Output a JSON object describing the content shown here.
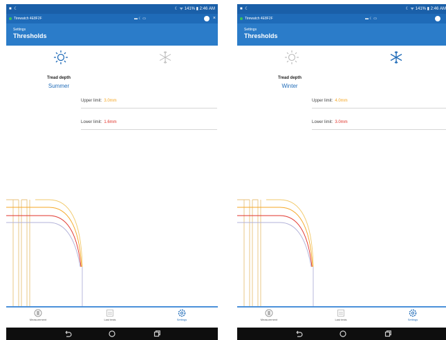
{
  "screens": [
    {
      "status_left": "■ ☾",
      "status_right": "☾ ᯤ 141% ▮ 2:46 AM",
      "device_name": "Tirewatch 4E8F2F",
      "notif_mid": "▬ ☾ ▭",
      "close_symbol": "×",
      "breadcrumb": "Settings",
      "title": "Thresholds",
      "season_icons": [
        "sun-icon",
        "snowflake-icon"
      ],
      "active_season": "summer",
      "tread_label": "Tread depth",
      "season_name": "Summer",
      "upper_limit_label": "Upper limit:",
      "upper_limit_value": "3.0mm",
      "lower_limit_label": "Lower limit:",
      "lower_limit_value": "1.6mm",
      "tabs": [
        {
          "label": "Measurement",
          "icon": "measure-tire-icon"
        },
        {
          "label": "Last tests",
          "icon": "last-tests-icon"
        },
        {
          "label": "Settings",
          "icon": "gear-icon",
          "active": true
        }
      ]
    },
    {
      "status_left": "■ ☾",
      "status_right": "☾ ᯤ 141% ▮ 2:46 AM",
      "device_name": "Tirewatch 4E8F2F",
      "notif_mid": "▬ ☾ ▭",
      "close_symbol": "×",
      "breadcrumb": "Settings",
      "title": "Thresholds",
      "season_icons": [
        "sun-icon",
        "snowflake-icon"
      ],
      "active_season": "winter",
      "tread_label": "Tread depth",
      "season_name": "Winter",
      "upper_limit_label": "Upper limit:",
      "upper_limit_value": "4.0mm",
      "lower_limit_label": "Lower limit:",
      "lower_limit_value": "3.0mm",
      "tabs": [
        {
          "label": "Measurement",
          "icon": "measure-tire-icon"
        },
        {
          "label": "Last tests",
          "icon": "last-tests-icon"
        },
        {
          "label": "Settings",
          "icon": "gear-icon",
          "active": true
        }
      ]
    }
  ],
  "colors": {
    "status_bar": "#1a5fa8",
    "app_bar": "#2b7cc9",
    "accent_blue": "#1f6bb8",
    "upper_value": "#f5a623",
    "lower_value": "#e0322a",
    "nav_bar": "#0e0e0e"
  },
  "system_nav_icons": [
    "back-icon",
    "home-icon",
    "recents-icon"
  ]
}
